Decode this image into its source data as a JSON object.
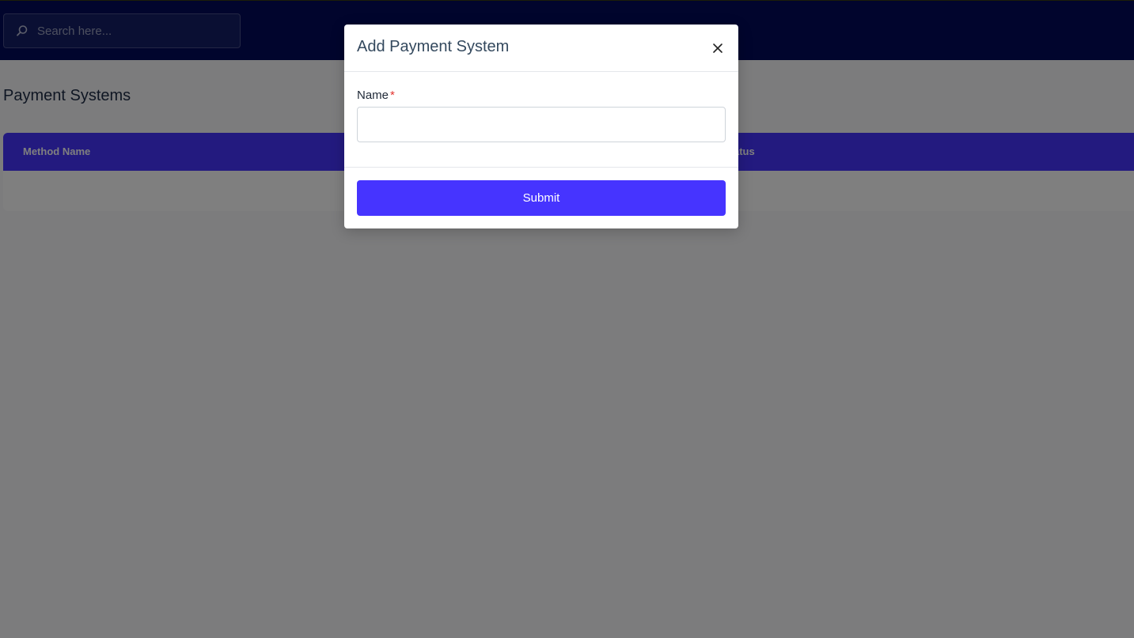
{
  "header": {
    "search": {
      "placeholder": "Search here...",
      "value": ""
    }
  },
  "page": {
    "title": "Payment Systems"
  },
  "table": {
    "columns": [
      "Method Name",
      "Status"
    ]
  },
  "modal": {
    "title": "Add Payment System",
    "fields": [
      {
        "label": "Name",
        "required_mark": "*",
        "value": ""
      }
    ],
    "submit_label": "Submit"
  },
  "colors": {
    "topbar": "#020b5a",
    "accent": "#4634ff",
    "required": "#e3342f"
  },
  "icons": {
    "search": "search-icon",
    "close": "close-icon"
  }
}
